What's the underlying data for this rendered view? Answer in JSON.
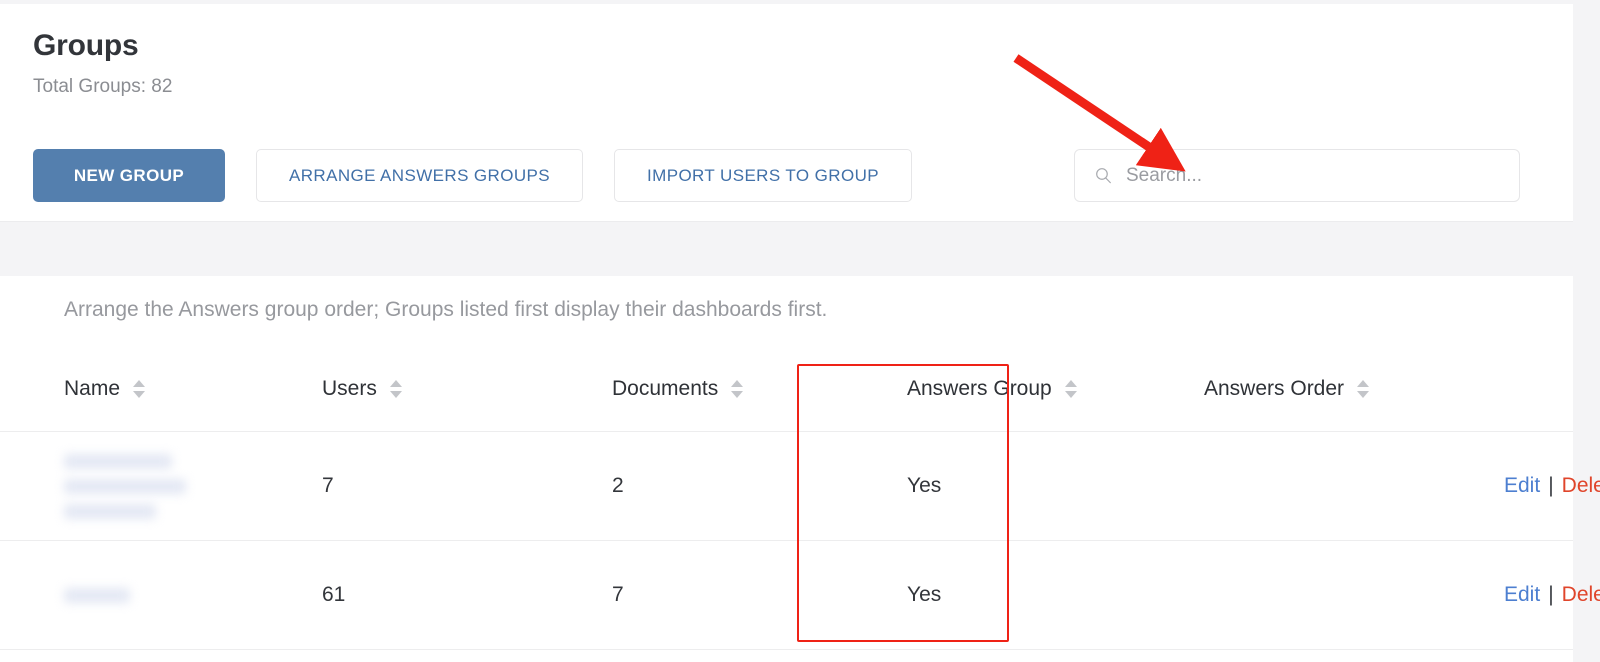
{
  "header": {
    "title": "Groups",
    "total_label": "Total Groups: 82"
  },
  "toolbar": {
    "new_group_label": "NEW GROUP",
    "arrange_answers_groups_label": "ARRANGE ANSWERS GROUPS",
    "import_users_label": "IMPORT USERS TO GROUP"
  },
  "search": {
    "value": "",
    "placeholder": "Search...",
    "icon": "search-icon"
  },
  "table": {
    "hint": "Arrange the Answers group order; Groups listed first display their dashboards first.",
    "columns": [
      {
        "label": "Name",
        "sortable": true,
        "sort_icon": "sort-both-icon"
      },
      {
        "label": "Users",
        "sortable": true,
        "sort_icon": "sort-both-icon"
      },
      {
        "label": "Documents",
        "sortable": true,
        "sort_icon": "sort-both-icon"
      },
      {
        "label": "Answers Group",
        "sortable": true,
        "sort_icon": "sort-both-icon"
      },
      {
        "label": "Answers Order",
        "sortable": true,
        "sort_icon": "sort-both-icon"
      },
      {
        "label": "",
        "sortable": false,
        "sort_icon": ""
      }
    ],
    "rows": [
      {
        "name": "",
        "name_redacted": true,
        "users": "7",
        "documents": "2",
        "answers_group": "Yes",
        "answers_order": "",
        "edit_label": "Edit",
        "separator": "|",
        "delete_label": "Delete"
      },
      {
        "name": "",
        "name_redacted": true,
        "users": "61",
        "documents": "7",
        "answers_group": "Yes",
        "answers_order": "",
        "edit_label": "Edit",
        "separator": "|",
        "delete_label": "Delete"
      }
    ]
  },
  "annotations": {
    "arrow": {
      "color": "#ef2216",
      "points_to": "search-input"
    },
    "highlight": {
      "color": "#ef2216",
      "target": "answers-group-column"
    }
  },
  "colors": {
    "primary_button": "#547fae",
    "link_blue": "#4d7fd0",
    "delete_red": "#e0452b",
    "annotation_red": "#ef2216",
    "page_background": "#f4f4f6"
  }
}
